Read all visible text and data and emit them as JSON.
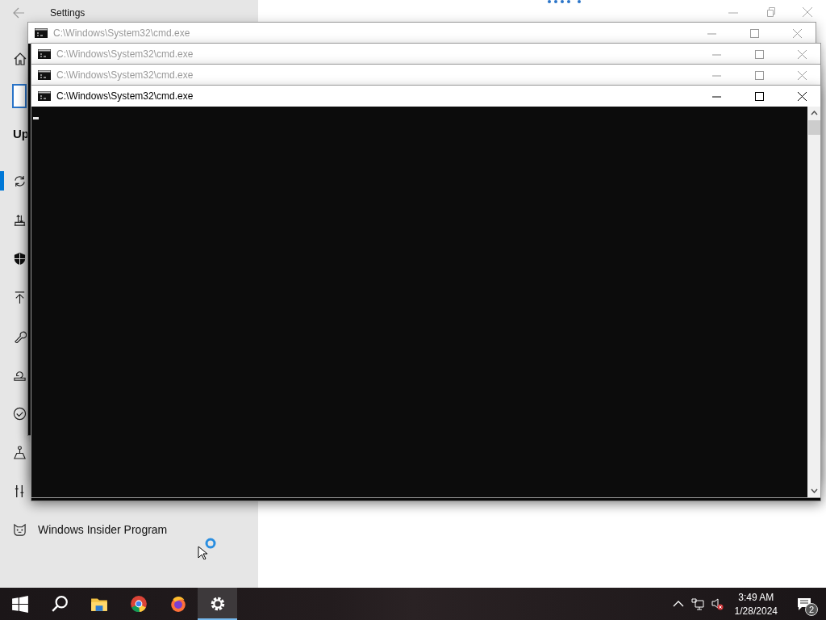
{
  "settings": {
    "title": "Settings",
    "heading": "Up",
    "sidebar": {
      "items": [
        {
          "kind": "sync",
          "selected": true
        },
        {
          "kind": "delivery",
          "selected": false
        },
        {
          "kind": "shield",
          "selected": false
        },
        {
          "kind": "backup",
          "selected": false
        },
        {
          "kind": "troubleshoot",
          "selected": false
        },
        {
          "kind": "recovery",
          "selected": false
        },
        {
          "kind": "activation",
          "selected": false
        },
        {
          "kind": "find",
          "selected": false
        },
        {
          "kind": "developer",
          "selected": false
        },
        {
          "kind": "insider",
          "selected": false,
          "label": "Windows Insider Program"
        }
      ]
    }
  },
  "cmd_windows": [
    {
      "title": "C:\\Windows\\System32\\cmd.exe",
      "active": false
    },
    {
      "title": "C:\\Windows\\System32\\cmd.exe",
      "active": false
    },
    {
      "title": "C:\\Windows\\System32\\cmd.exe",
      "active": false
    },
    {
      "title": "C:\\Windows\\System32\\cmd.exe",
      "active": true
    }
  ],
  "taskbar": {
    "apps": [
      {
        "kind": "start",
        "selected": false
      },
      {
        "kind": "search",
        "selected": false
      },
      {
        "kind": "files",
        "selected": false
      },
      {
        "kind": "chrome",
        "selected": false
      },
      {
        "kind": "firefox",
        "selected": false
      },
      {
        "kind": "settings",
        "selected": true
      }
    ],
    "time": "3:49 AM",
    "date": "1/28/2024",
    "notifications": "2"
  }
}
